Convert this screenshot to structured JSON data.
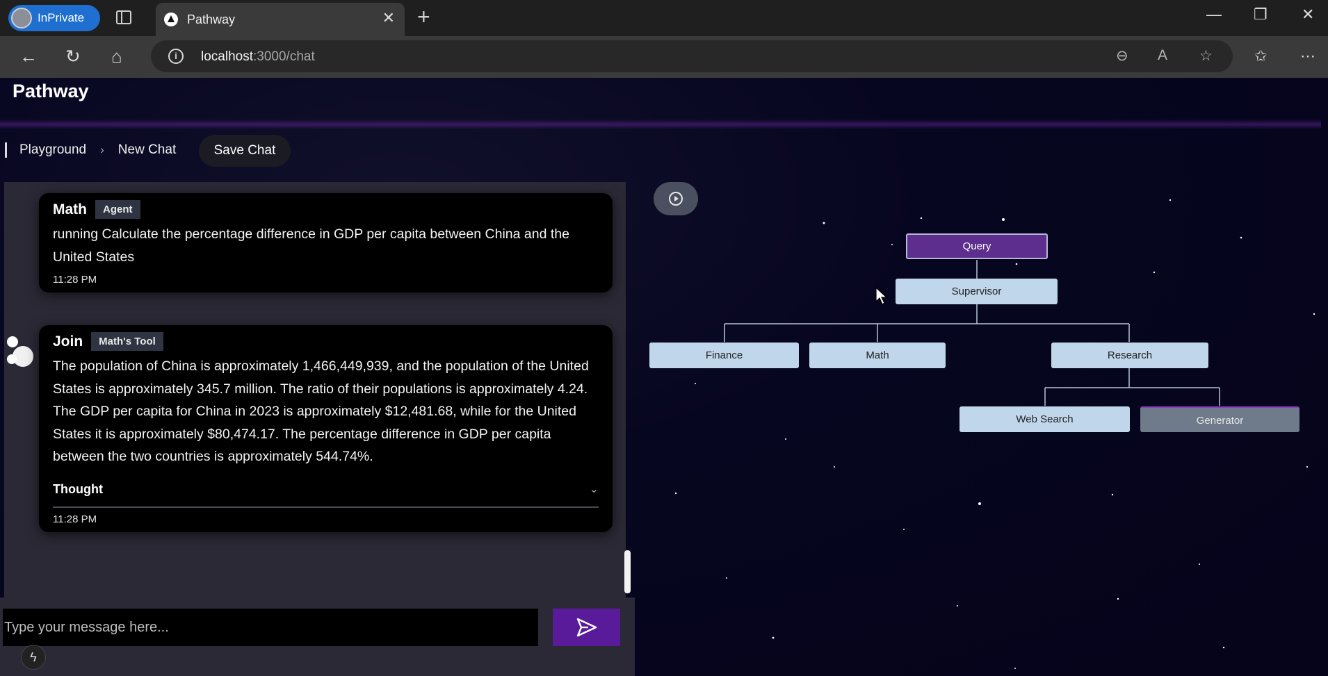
{
  "browser": {
    "profile_label": "InPrivate",
    "tab_title": "Pathway",
    "url_host": "localhost",
    "url_path": ":3000/chat"
  },
  "app": {
    "brand": "Pathway",
    "breadcrumb": [
      "Playground",
      "New Chat"
    ],
    "save_label": "Save Chat"
  },
  "messages": [
    {
      "name": "Math",
      "badge": "Agent",
      "text": "running Calculate the percentage difference in GDP per capita between China and the United States",
      "time": "11:28 PM"
    },
    {
      "name": "Join",
      "badge": "Math's Tool",
      "text": "The population of China is approximately 1,466,449,939, and the population of the United States is approximately 345.7 million. The ratio of their populations is approximately 4.24. The GDP per capita for China in 2023 is approximately $12,481.68, while for the United States it is approximately $80,474.17. The percentage difference in GDP per capita between the two countries is approximately 544.74%.",
      "thought_label": "Thought",
      "time": "11:28 PM"
    }
  ],
  "composer": {
    "placeholder": "Type your message here..."
  },
  "graph": {
    "nodes": {
      "query": "Query",
      "supervisor": "Supervisor",
      "finance": "Finance",
      "math": "Math",
      "research": "Research",
      "web_search": "Web Search",
      "generator": "Generator"
    }
  },
  "colors": {
    "accent": "#5a1b9a",
    "query_node": "#5e2e8f",
    "node": "#c0d6eb",
    "background": "#06051a"
  }
}
